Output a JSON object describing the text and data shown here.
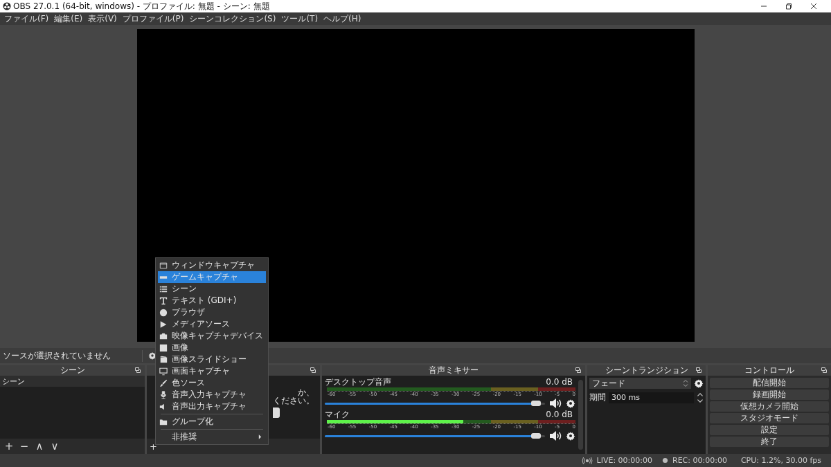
{
  "window": {
    "title": "OBS 27.0.1 (64-bit, windows) - プロファイル: 無題 - シーン: 無題"
  },
  "menu_bar": [
    "ファイル(F)",
    "編集(E)",
    "表示(V)",
    "プロファイル(P)",
    "シーンコレクション(S)",
    "ツール(T)",
    "ヘルプ(H)"
  ],
  "source_toolbar": {
    "status": "ソースが選択されていません"
  },
  "scenes": {
    "title": "シーン",
    "items": [
      {
        "label": "シーン",
        "selected": true
      }
    ],
    "buttons": [
      "+",
      "−",
      "∧",
      "∨"
    ]
  },
  "sources": {
    "hint_lines": [
      "か、",
      "ください。"
    ],
    "buttons": [
      "+"
    ]
  },
  "context_menu": {
    "items": [
      {
        "kind": "item",
        "label": "ウィンドウキャプチャ",
        "selected": false
      },
      {
        "kind": "item",
        "label": "ゲームキャプチャ",
        "selected": true
      },
      {
        "kind": "item",
        "label": "シーン",
        "selected": false
      },
      {
        "kind": "item",
        "label": "テキスト (GDI+)",
        "selected": false
      },
      {
        "kind": "item",
        "label": "ブラウザ",
        "selected": false
      },
      {
        "kind": "item",
        "label": "メディアソース",
        "selected": false
      },
      {
        "kind": "item",
        "label": "映像キャプチャデバイス",
        "selected": false
      },
      {
        "kind": "item",
        "label": "画像",
        "selected": false
      },
      {
        "kind": "item",
        "label": "画像スライドショー",
        "selected": false
      },
      {
        "kind": "item",
        "label": "画面キャプチャ",
        "selected": false
      },
      {
        "kind": "item",
        "label": "色ソース",
        "selected": false
      },
      {
        "kind": "item",
        "label": "音声入力キャプチャ",
        "selected": false
      },
      {
        "kind": "item",
        "label": "音声出力キャプチャ",
        "selected": false
      },
      {
        "kind": "separator"
      },
      {
        "kind": "item",
        "label": "グループ化",
        "selected": false
      },
      {
        "kind": "separator"
      },
      {
        "kind": "submenu",
        "label": "非推奨",
        "selected": false
      }
    ]
  },
  "audio_mixer": {
    "title": "音声ミキサー",
    "channels": [
      {
        "name": "デスクトップ音声",
        "reading": "0.0 dB",
        "meter": {
          "level": 0
        },
        "scale": [
          "-60",
          "-55",
          "-50",
          "-45",
          "-40",
          "-35",
          "-30",
          "-25",
          "-20",
          "-15",
          "-10",
          "-5",
          "0"
        ],
        "volume": {
          "level": 0.97
        }
      },
      {
        "name": "マイク",
        "reading": "0.0 dB",
        "meter": {
          "level": 0.55
        },
        "scale": [
          "-60",
          "-55",
          "-50",
          "-45",
          "-40",
          "-35",
          "-30",
          "-25",
          "-20",
          "-15",
          "-10",
          "-5",
          "0"
        ],
        "volume": {
          "level": 0.97
        }
      }
    ]
  },
  "scene_transitions": {
    "title": "シーントランジション",
    "transition": "フェード",
    "duration_label": "期間",
    "duration": "300 ms"
  },
  "controls": {
    "title": "コントロール",
    "buttons": [
      "配信開始",
      "録画開始",
      "仮想カメラ開始",
      "スタジオモード",
      "設定",
      "終了"
    ]
  },
  "status_bar": {
    "live": "LIVE: 00:00:00",
    "rec": "REC: 00:00:00",
    "cpu": "CPU: 1.2%, 30.00 fps"
  }
}
